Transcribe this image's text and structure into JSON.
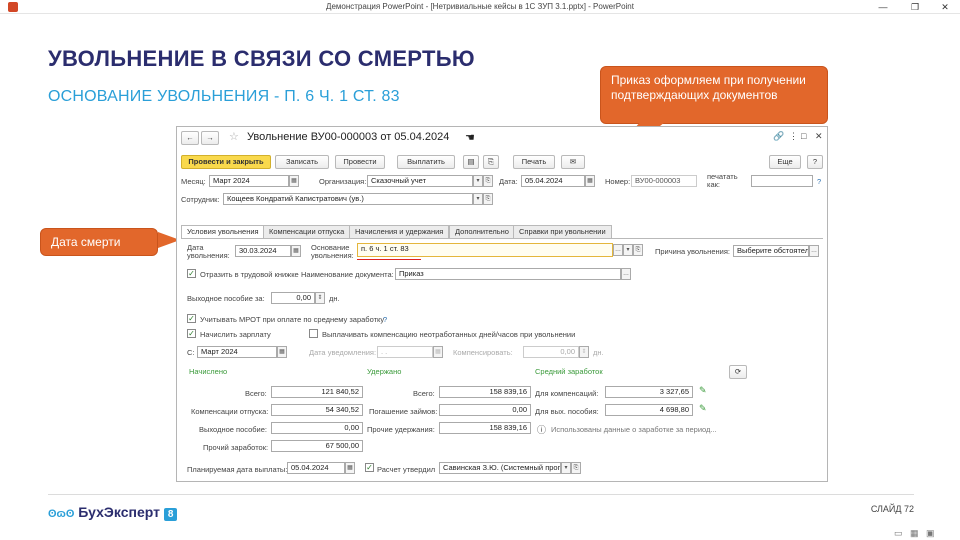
{
  "window": {
    "title": "Демонстрация PowerPoint - [Нетривиальные кейсы в 1С ЗУП 3.1.pptx] - PowerPoint",
    "minimize": "—",
    "restore": "❐",
    "close": "✕"
  },
  "slide": {
    "heading": "УВОЛЬНЕНИЕ В СВЯЗИ СО СМЕРТЬЮ",
    "subheading": "ОСНОВАНИЕ УВОЛЬНЕНИЯ - П. 6 Ч. 1 СТ. 83",
    "callout_top": "Приказ оформляем при получении подтверждающих документов",
    "callout_left": "Дата смерти",
    "logo_text": "БухЭксперт",
    "logo_badge": "8",
    "slide_number": "СЛАЙД 72",
    "colors": {
      "heading": "#2b2d6e",
      "subheading": "#2a9fd8",
      "callout": "#e2672b"
    }
  },
  "form": {
    "title": "Увольнение ВУ00-000003 от 05.04.2024",
    "toolbar": {
      "post_close": "Провести и закрыть",
      "save": "Записать",
      "post": "Провести",
      "pay": "Выплатить",
      "print": "Печать",
      "more": "Еще",
      "help": "?"
    },
    "header": {
      "month_label": "Месяц:",
      "month_value": "Март 2024",
      "org_label": "Организация:",
      "org_value": "Сказочный учет",
      "date_label": "Дата:",
      "date_value": "05.04.2024",
      "number_label": "Номер:",
      "number_value": "ВУ00-000003",
      "print_as_label": "печатать как:",
      "employee_label": "Сотрудник:",
      "employee_value": "Кощеев Кондратий Капистратович (ув.)"
    },
    "tabs": [
      "Условия увольнения",
      "Компенсации отпуска",
      "Начисления и удержания",
      "Дополнительно",
      "Справки при увольнении"
    ],
    "conditions": {
      "dismissal_date_label": "Дата увольнения:",
      "dismissal_date_value": "30.03.2024",
      "basis_label": "Основание увольнения:",
      "basis_value": "п. 6 ч. 1 ст. 83",
      "reason_label": "Причина увольнения:",
      "reason_value": "Выберите обстоятел",
      "reflect_label": "Отразить в трудовой книжке",
      "docname_label": "Наименование документа:",
      "docname_value": "Приказ",
      "holiday_label": "Выходное пособие за:",
      "holiday_value": "0,00",
      "holiday_unit": "дн.",
      "mrot_label": "Учитывать МРОТ при оплате по среднему заработку",
      "salary_label": "Начислить зарплату",
      "pay_comp_label": "Выплачивать компенсацию неотработанных дней/часов при увольнении",
      "from_label": "С:",
      "from_value": "Март 2024",
      "notice_label": "Дата уведомления:",
      "notice_value": ". .",
      "compensate_label": "Компенсировать:",
      "compensate_value": "0,00",
      "compensate_unit": "дн."
    },
    "totals": {
      "accrued_header": "Начислено",
      "withheld_header": "Удержано",
      "average_header": "Средний заработок",
      "total_label": "Всего:",
      "accrued_total": "121 840,52",
      "vacation_comp_label": "Компенсации отпуска:",
      "vacation_comp": "54 340,52",
      "severance_label": "Выходное пособие:",
      "severance": "0,00",
      "other_label": "Прочий заработок:",
      "other": "67 500,00",
      "withheld_total": "158 839,16",
      "loans_label": "Погашение займов:",
      "loans": "0,00",
      "other_withheld_label": "Прочие удержания:",
      "other_withheld": "158 839,16",
      "for_comp_label": "Для компенсаций:",
      "for_comp": "3 327,65",
      "for_severance_label": "Для вых. пособия:",
      "for_severance": "4 698,80",
      "info_text": "Использованы данные о заработке за период..."
    },
    "footer": {
      "planned_date_label": "Планируемая дата выплаты:",
      "planned_date_value": "05.04.2024",
      "approved_label": "Расчет утвердил",
      "approved_value": "Савинская З.Ю. (Системный прог"
    }
  }
}
